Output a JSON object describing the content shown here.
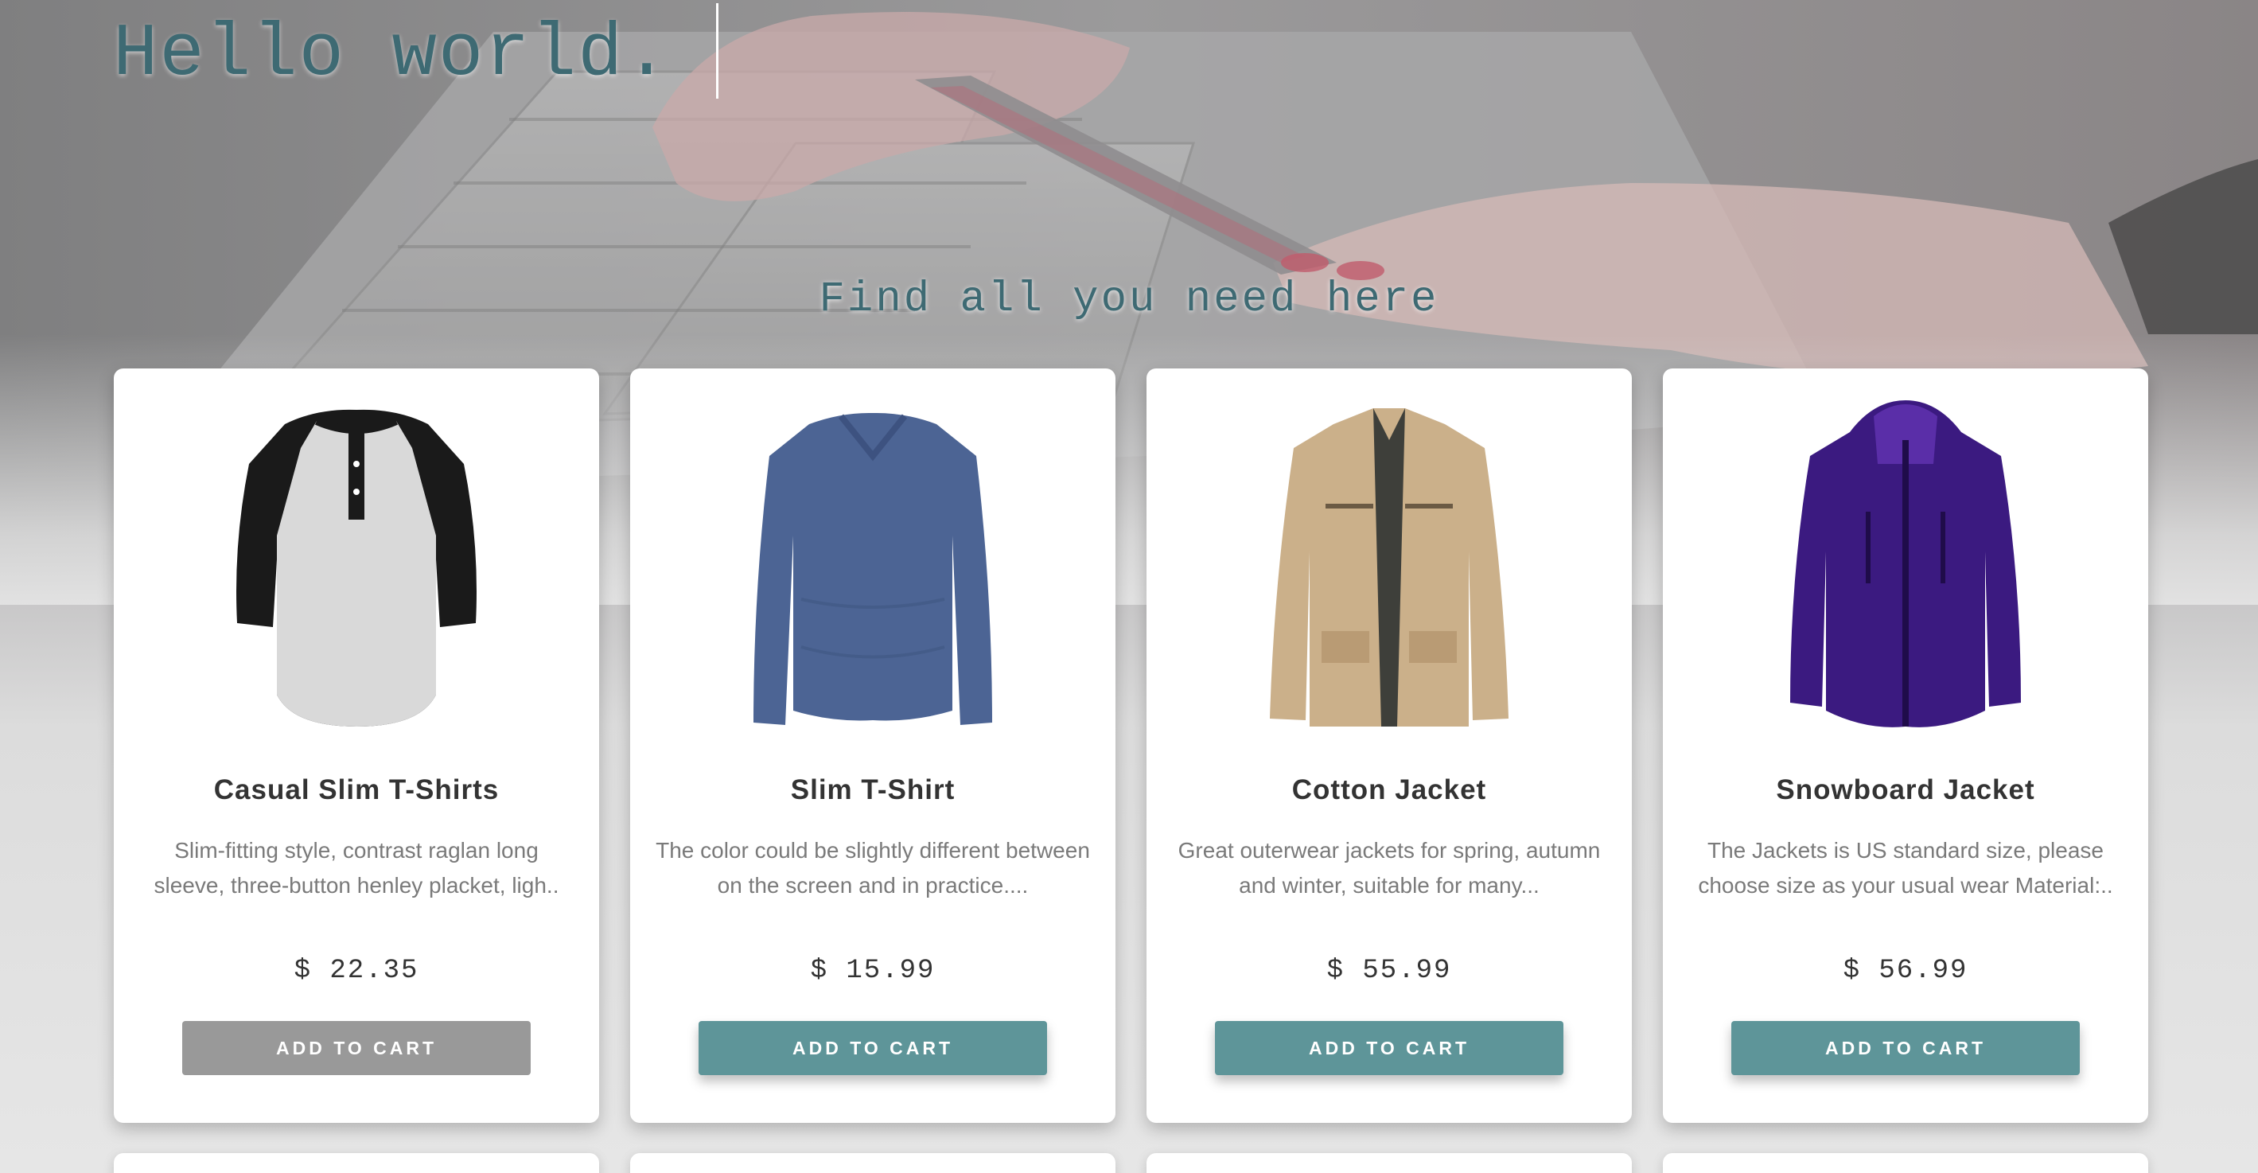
{
  "hero": {
    "heading": "Hello world.",
    "tagline": "Find all you need here"
  },
  "colors": {
    "accent": "#5e9599",
    "heading": "#3e6a73",
    "button_disabled": "#999999"
  },
  "products": [
    {
      "title": "Casual Slim T-Shirts",
      "description": "Slim-fitting style, contrast raglan long sleeve, three-button henley placket, ligh..",
      "price": "$ 22.35",
      "button_label": "ADD TO CART",
      "image_icon": "raglan-henley-shirt-icon"
    },
    {
      "title": "Slim T-Shirt",
      "description": "The color could be slightly different between on the screen and in practice....",
      "price": "$ 15.99",
      "button_label": "ADD TO CART",
      "image_icon": "long-sleeve-tshirt-icon"
    },
    {
      "title": "Cotton Jacket",
      "description": "Great outerwear jackets for spring, autumn and winter, suitable for many...",
      "price": "$ 55.99",
      "button_label": "ADD TO CART",
      "image_icon": "cotton-jacket-icon"
    },
    {
      "title": "Snowboard Jacket",
      "description": "The Jackets is US standard size, please choose size as your usual wear Material:..",
      "price": "$ 56.99",
      "button_label": "ADD TO CART",
      "image_icon": "snowboard-jacket-icon"
    }
  ]
}
